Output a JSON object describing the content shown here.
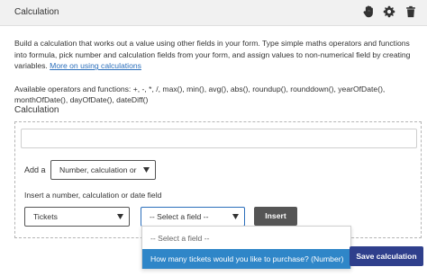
{
  "header": {
    "title": "Calculation",
    "icons": [
      "drag-hand-icon",
      "gear-icon",
      "trash-icon"
    ]
  },
  "description": {
    "text": "Build a calculation that works out a value using other fields in your form. Type simple maths operators and functions into formula, pick number and calculation fields from your form, and assign values to non-numerical field by creating variables. ",
    "link": "More on using calculations"
  },
  "operators": {
    "text": "Available operators and functions: +, -, *, /, max(), min(), avg(), abs(), roundup(), rounddown(), yearOfDate(), monthOfDate(), dayOfDate(), dateDiff()"
  },
  "section": {
    "label": "Calculation"
  },
  "formula": {
    "value": ""
  },
  "add_row": {
    "label": "Add a",
    "select_value": "Number, calculation or"
  },
  "insert_row": {
    "label": "Insert a number, calculation or date field",
    "page_select_value": "Tickets",
    "field_select_value": "-- Select a field --",
    "insert_button": "Insert"
  },
  "dropdown": {
    "options": [
      "-- Select a field --",
      "How many tickets would you like to purchase? (Number)"
    ]
  },
  "footer": {
    "save_button": "Save calculation"
  },
  "colors": {
    "header_bg": "#f1f1f1",
    "link": "#2a6ebb",
    "insert_button_bg": "#555555",
    "dropdown_highlight": "#2f86c8",
    "save_button_bg": "#2f3f8c"
  }
}
